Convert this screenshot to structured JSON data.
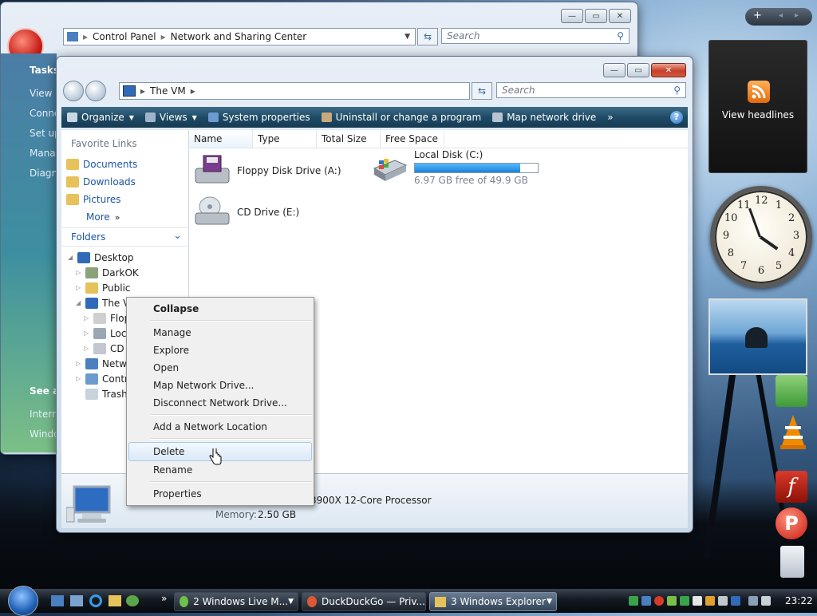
{
  "back_window": {
    "address_path": [
      "Control Panel",
      "Network and Sharing Center"
    ],
    "search_placeholder": "Search",
    "tasks_header": "Tasks",
    "partial_links": [
      "View c",
      "Conne",
      "Set up",
      "Manag",
      "Diagno"
    ],
    "see_also": "See al",
    "partial_links_bottom": [
      "Intern",
      "Windo"
    ]
  },
  "front_window": {
    "address": "The VM",
    "search_placeholder": "Search",
    "toolbar": {
      "organize": "Organize",
      "views": "Views",
      "system_properties": "System properties",
      "uninstall": "Uninstall or change a program",
      "map_drive": "Map network drive",
      "more": "»"
    },
    "favorite_links": {
      "header": "Favorite Links",
      "items": [
        "Documents",
        "Downloads",
        "Pictures"
      ],
      "more": "More"
    },
    "folders": {
      "header": "Folders",
      "tree": [
        "Desktop",
        "DarkOK",
        "Public",
        "The VM",
        "Flop",
        "Loc",
        "CD",
        "Netw",
        "Contr",
        "Trash"
      ]
    },
    "columns": [
      "Name",
      "Type",
      "Total Size",
      "Free Space"
    ],
    "drives": [
      {
        "name": "Floppy Disk Drive (A:)"
      },
      {
        "name": "Local Disk (C:)",
        "free_text": "6.97 GB free of 49.9 GB",
        "used_fraction": 0.86
      },
      {
        "name": "CD Drive (E:)"
      }
    ],
    "details": {
      "processor": "3900X 12-Core Processor",
      "memory_label": "Memory:",
      "memory_value": "2.50 GB"
    }
  },
  "context_menu": {
    "items": [
      "Collapse",
      "Manage",
      "Explore",
      "Open",
      "Map Network Drive...",
      "Disconnect Network Drive...",
      "Add a Network Location",
      "Delete",
      "Rename",
      "Properties"
    ],
    "highlighted": "Delete"
  },
  "sidebar": {
    "feed_label": "View headlines",
    "clock_numbers": [
      "12",
      "1",
      "2",
      "3",
      "4",
      "5",
      "6",
      "7",
      "8",
      "9",
      "10",
      "11"
    ]
  },
  "taskbar": {
    "buttons": [
      "2 Windows Live M...",
      "DuckDuckGo — Priv...",
      "3 Windows Explorer"
    ],
    "overflow": "»",
    "time": "23:22"
  },
  "colors": {
    "toolbar": "#1f4b66",
    "link": "#1b54a8",
    "progress": "#1a83d6"
  }
}
